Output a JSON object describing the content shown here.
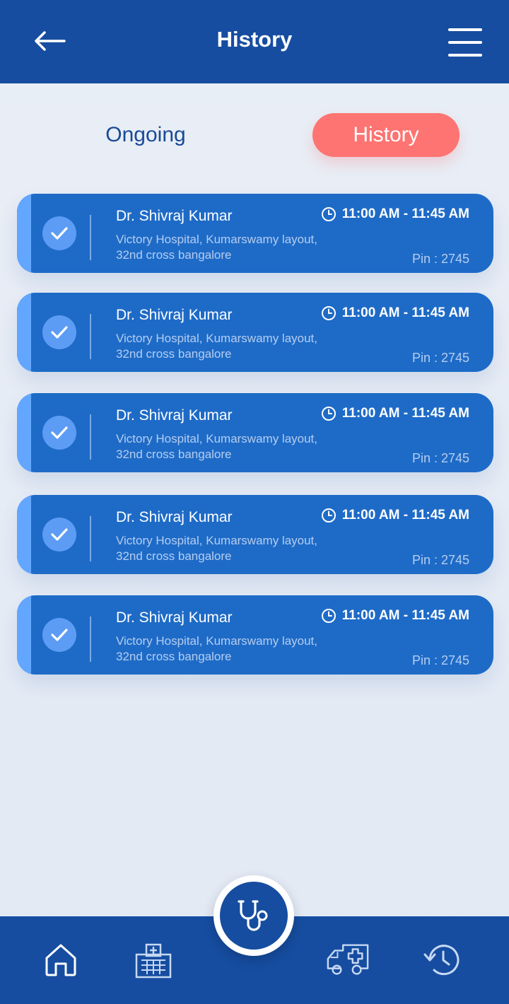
{
  "header": {
    "title": "History"
  },
  "tabs": {
    "ongoing": "Ongoing",
    "history": "History",
    "active": "history"
  },
  "colors": {
    "primary": "#164da0",
    "card": "#1e6bc7",
    "accent": "#fd7472",
    "stripe": "#62a6ff"
  },
  "appointments": [
    {
      "doctor": "Dr. Shivraj Kumar",
      "address_line1": "Victory Hospital, Kumarswamy layout,",
      "address_line2": "32nd cross bangalore",
      "time": "11:00 AM - 11:45 AM",
      "pin": "Pin : 2745",
      "status_icon": "check-icon"
    },
    {
      "doctor": "Dr. Shivraj Kumar",
      "address_line1": "Victory Hospital, Kumarswamy layout,",
      "address_line2": "32nd cross bangalore",
      "time": "11:00 AM - 11:45 AM",
      "pin": "Pin : 2745",
      "status_icon": "check-icon"
    },
    {
      "doctor": "Dr. Shivraj Kumar",
      "address_line1": "Victory Hospital, Kumarswamy layout,",
      "address_line2": "32nd cross bangalore",
      "time": "11:00 AM - 11:45 AM",
      "pin": "Pin : 2745",
      "status_icon": "check-icon"
    },
    {
      "doctor": "Dr. Shivraj Kumar",
      "address_line1": "Victory Hospital, Kumarswamy layout,",
      "address_line2": "32nd cross bangalore",
      "time": "11:00 AM - 11:45 AM",
      "pin": "Pin : 2745",
      "status_icon": "check-icon"
    },
    {
      "doctor": "Dr. Shivraj Kumar",
      "address_line1": "Victory Hospital, Kumarswamy layout,",
      "address_line2": "32nd cross bangalore",
      "time": "11:00 AM - 11:45 AM",
      "pin": "Pin : 2745",
      "status_icon": "check-icon"
    }
  ],
  "bottom_nav": {
    "items": [
      "home-icon",
      "hospital-icon",
      "stethoscope-icon",
      "ambulance-icon",
      "history-icon"
    ],
    "center": "stethoscope-icon"
  }
}
